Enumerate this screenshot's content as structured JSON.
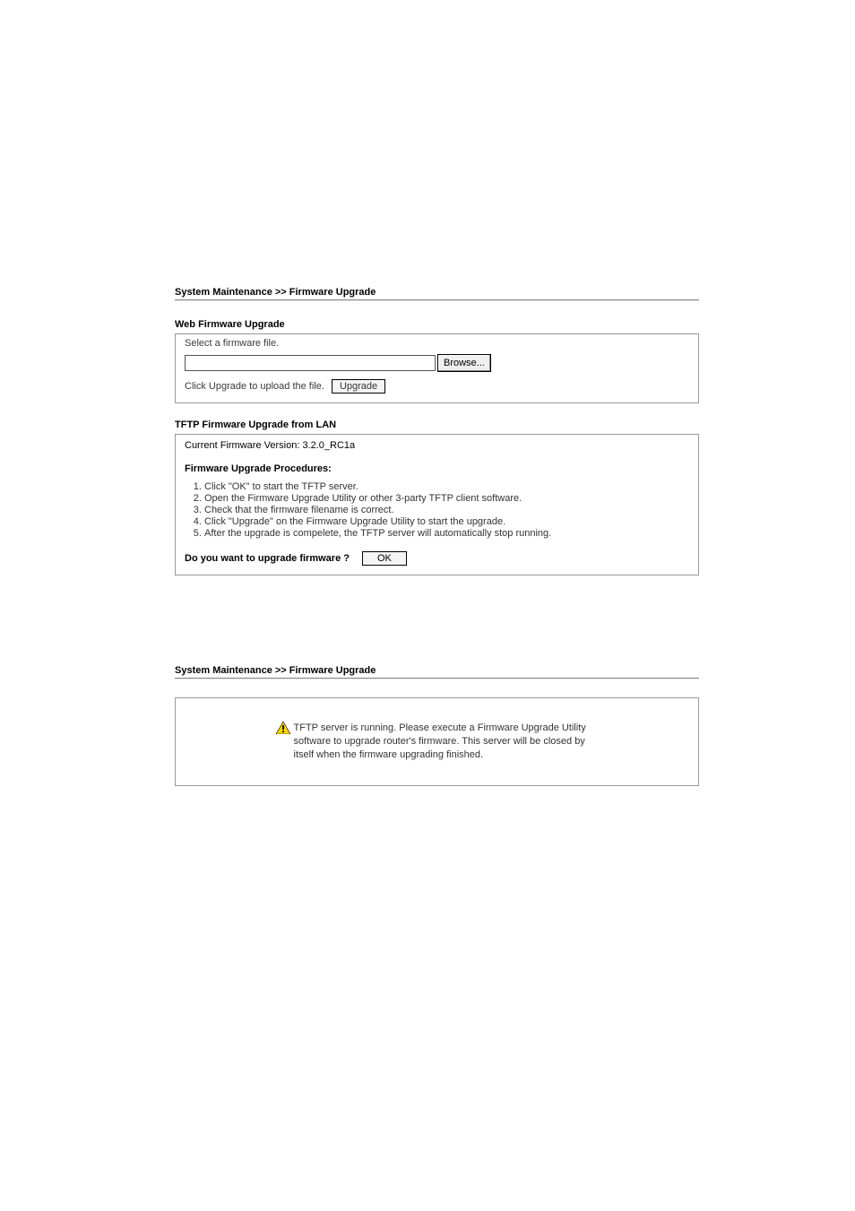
{
  "breadcrumb": "System Maintenance >> Firmware Upgrade",
  "web_upgrade": {
    "title": "Web Firmware Upgrade",
    "select_label": "Select a firmware file.",
    "file_value": "",
    "browse_label": "Browse...",
    "upload_text": "Click Upgrade to upload the file.",
    "upgrade_button": "Upgrade"
  },
  "tftp": {
    "title": "TFTP Firmware Upgrade from LAN",
    "current_version_label": "Current Firmware Version:",
    "current_version_value": "3.2.0_RC1a",
    "procedures_title": "Firmware Upgrade Procedures:",
    "steps": [
      "Click \"OK\" to start the TFTP server.",
      "Open the Firmware Upgrade Utility or other 3-party TFTP client software.",
      "Check that the firmware filename is correct.",
      "Click \"Upgrade\" on the Firmware Upgrade Utility to start the upgrade.",
      "After the upgrade is compelete, the TFTP server will automatically stop running."
    ],
    "confirm_question": "Do you want to upgrade firmware ?",
    "ok_button": "OK"
  },
  "status": {
    "message": "TFTP server is running. Please execute a Firmware Upgrade Utility software to upgrade router's firmware. This server will be closed by itself when the firmware upgrading finished."
  }
}
